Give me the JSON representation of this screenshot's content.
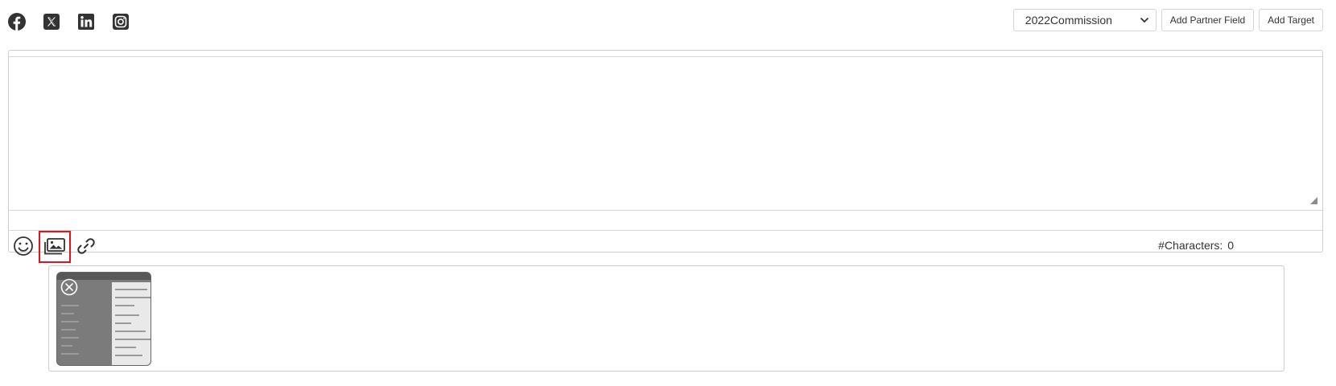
{
  "social": {
    "icons": [
      "facebook-icon",
      "x-twitter-icon",
      "linkedin-icon",
      "instagram-icon"
    ]
  },
  "header": {
    "commission_select": {
      "value": "2022Commission"
    },
    "add_partner_field_label": "Add Partner Field",
    "add_target_label": "Add Target"
  },
  "editor": {
    "value": "",
    "tools": [
      "emoji-icon",
      "image-gallery-icon",
      "link-icon"
    ],
    "highlighted_tool": "image-gallery-icon",
    "char_count_label": "#Characters:",
    "char_count": "0"
  },
  "attachments": {
    "items": [
      {
        "type": "image",
        "removable": true
      }
    ]
  },
  "colors": {
    "highlight": "#e0141b",
    "border": "#cfcfcf",
    "icon": "#333333"
  }
}
